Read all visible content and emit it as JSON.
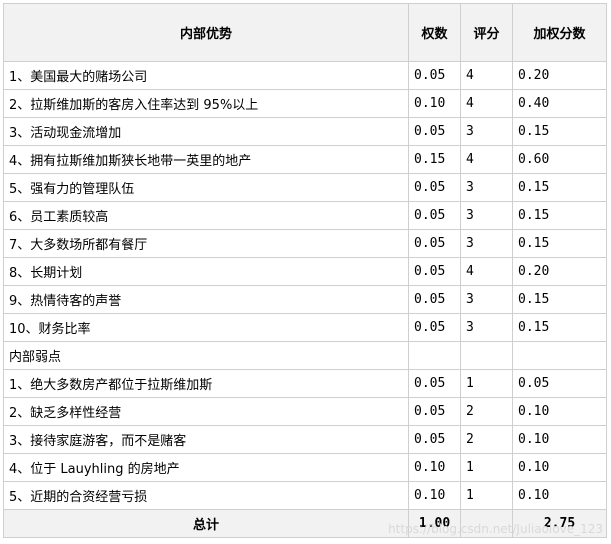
{
  "header": {
    "factor": "内部优势",
    "weight": "权数",
    "rating": "评分",
    "weighted": "加权分数"
  },
  "strengths": [
    {
      "item": "1、美国最大的赌场公司",
      "weight": "0.05",
      "rating": "4",
      "weighted": "0.20"
    },
    {
      "item": "2、拉斯维加斯的客房入住率达到 95%以上",
      "weight": "0.10",
      "rating": "4",
      "weighted": "0.40"
    },
    {
      "item": "3、活动现金流增加",
      "weight": "0.05",
      "rating": "3",
      "weighted": "0.15"
    },
    {
      "item": "4、拥有拉斯维加斯狭长地带一英里的地产",
      "weight": "0.15",
      "rating": "4",
      "weighted": "0.60"
    },
    {
      "item": "5、强有力的管理队伍",
      "weight": "0.05",
      "rating": "3",
      "weighted": "0.15"
    },
    {
      "item": "6、员工素质较高",
      "weight": "0.05",
      "rating": "3",
      "weighted": "0.15"
    },
    {
      "item": "7、大多数场所都有餐厅",
      "weight": "0.05",
      "rating": "3",
      "weighted": "0.15"
    },
    {
      "item": "8、长期计划",
      "weight": "0.05",
      "rating": "4",
      "weighted": "0.20"
    },
    {
      "item": "9、热情待客的声誉",
      "weight": "0.05",
      "rating": "3",
      "weighted": "0.15"
    },
    {
      "item": "10、财务比率",
      "weight": "0.05",
      "rating": "3",
      "weighted": "0.15"
    }
  ],
  "weakness_heading": "内部弱点",
  "weaknesses": [
    {
      "item": "1、绝大多数房产都位于拉斯维加斯",
      "weight": "0.05",
      "rating": "1",
      "weighted": "0.05"
    },
    {
      "item": "2、缺乏多样性经营",
      "weight": "0.05",
      "rating": "2",
      "weighted": "0.10"
    },
    {
      "item": "3、接待家庭游客，而不是赌客",
      "weight": "0.05",
      "rating": "2",
      "weighted": "0.10"
    },
    {
      "item": "4、位于 Lauyhling 的房地产",
      "weight": "0.10",
      "rating": "1",
      "weighted": "0.10"
    },
    {
      "item": "5、近期的合资经营亏损",
      "weight": "0.10",
      "rating": "1",
      "weighted": "0.10"
    }
  ],
  "total": {
    "label": "总计",
    "weight": "1.00",
    "weighted": "2.75"
  },
  "watermark": "https://blog.csdn.net/Juliaolove_123"
}
